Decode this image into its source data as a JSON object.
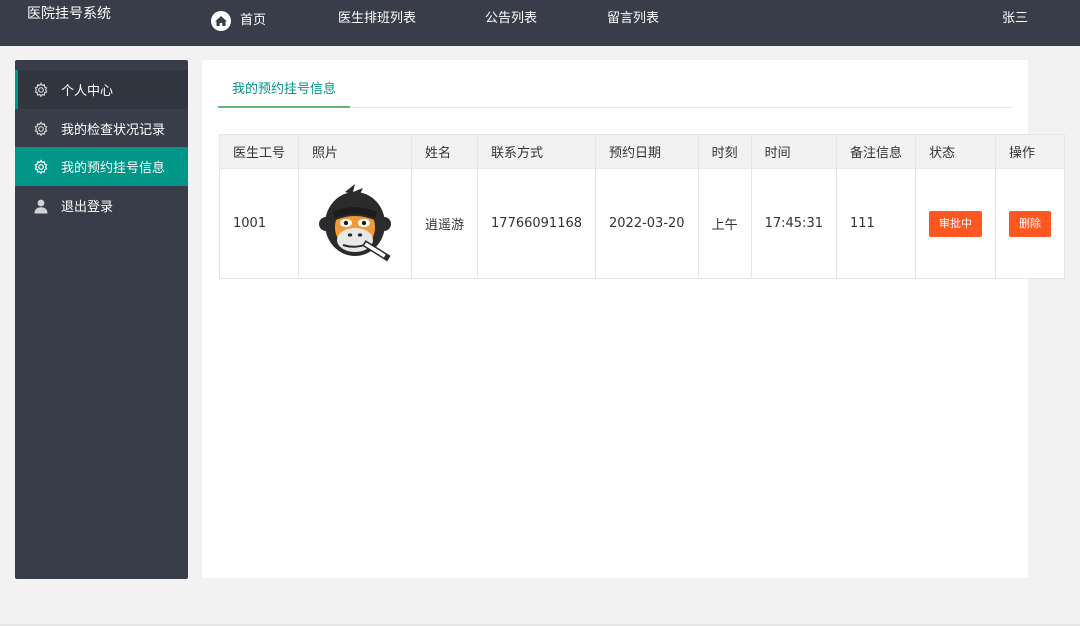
{
  "header": {
    "brand": "医院挂号系统",
    "nav": [
      {
        "label": "首页",
        "icon": "home-icon"
      },
      {
        "label": "医生排班列表"
      },
      {
        "label": "公告列表"
      },
      {
        "label": "留言列表"
      }
    ],
    "user": "张三"
  },
  "sidebar": {
    "items": [
      {
        "label": "个人中心",
        "icon": "gear-icon"
      },
      {
        "label": "我的检查状况记录",
        "icon": "gear-icon"
      },
      {
        "label": "我的预约挂号信息",
        "icon": "gear-icon",
        "active": true
      },
      {
        "label": "退出登录",
        "icon": "user-icon"
      }
    ]
  },
  "main": {
    "tab": "我的预约挂号信息",
    "table": {
      "columns": [
        "医生工号",
        "照片",
        "姓名",
        "联系方式",
        "预约日期",
        "时刻",
        "时间",
        "备注信息",
        "状态",
        "操作"
      ],
      "rows": [
        {
          "doctor_id": "1001",
          "photo": "gorilla-logo",
          "name": "逍遥游",
          "phone": "17766091168",
          "date": "2022-03-20",
          "period": "上午",
          "time": "17:45:31",
          "note": "111",
          "status": "审批中",
          "action": "删除"
        }
      ]
    }
  },
  "colors": {
    "topbar": "#393d49",
    "sidebar": "#393d49",
    "accent": "#009688",
    "button": "#ff5722"
  }
}
